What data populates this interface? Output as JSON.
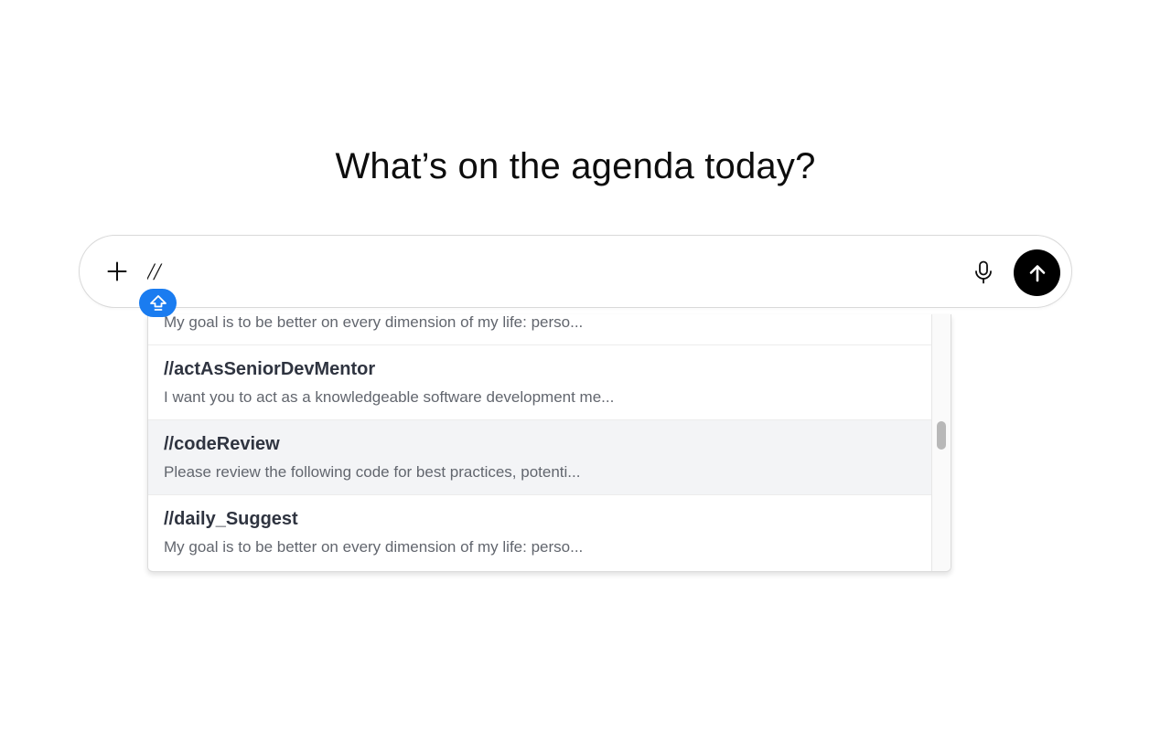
{
  "headline": "What’s on the agenda today?",
  "composer": {
    "input_value": "//",
    "plus_icon": "plus-icon",
    "mic_icon": "microphone-icon",
    "send_icon": "arrow-up-icon",
    "shift_badge_icon": "shift-key-icon",
    "accent_color": "#1a7cf0"
  },
  "suggestions": {
    "items": [
      {
        "name": "",
        "description": "My goal is to be better on every dimension of my life: perso..."
      },
      {
        "name": "//actAsSeniorDevMentor",
        "description": "I want you to act as a knowledgeable software development me..."
      },
      {
        "name": "//codeReview",
        "description": "Please review the following code for best practices, potenti..."
      },
      {
        "name": "//daily_Suggest",
        "description": "My goal is to be better on every dimension of my life: perso..."
      }
    ],
    "active_index": 2
  }
}
